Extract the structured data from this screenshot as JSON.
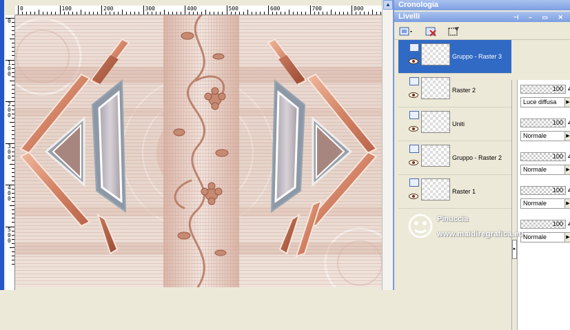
{
  "editor": {
    "hruler_labels": [
      "0",
      "100",
      "200",
      "300",
      "400",
      "500",
      "600",
      "700",
      "800"
    ],
    "vruler_labels": [
      "0",
      "1\n0\n0",
      "2\n0\n0",
      "3\n0\n0",
      "4\n0\n0",
      "5\n0\n0"
    ],
    "canvas_palette": {
      "background": "#e8d8d0",
      "accent": "#c88a72",
      "frame": "#8a9aa8"
    }
  },
  "history_panel": {
    "title": "Cronologia"
  },
  "layers_panel": {
    "title": "Livelli",
    "toolbar_icons": [
      "new-layer-icon",
      "delete-layer-icon",
      "mask-icon"
    ],
    "layers": [
      {
        "name": "Gruppo - Raster 3",
        "opacity": "100",
        "blend": "Luce diffusa",
        "selected": true
      },
      {
        "name": "Raster 2",
        "opacity": "100",
        "blend": "Normale",
        "selected": false
      },
      {
        "name": "Uniti",
        "opacity": "100",
        "blend": "Normale",
        "selected": false
      },
      {
        "name": "Gruppo - Raster 2",
        "opacity": "100",
        "blend": "Normale",
        "selected": false
      },
      {
        "name": "Raster 1",
        "opacity": "100",
        "blend": "Normale",
        "selected": false
      }
    ]
  },
  "watermark": {
    "name": "Pinuccia",
    "url": "www.maidiregrafica.eu"
  }
}
